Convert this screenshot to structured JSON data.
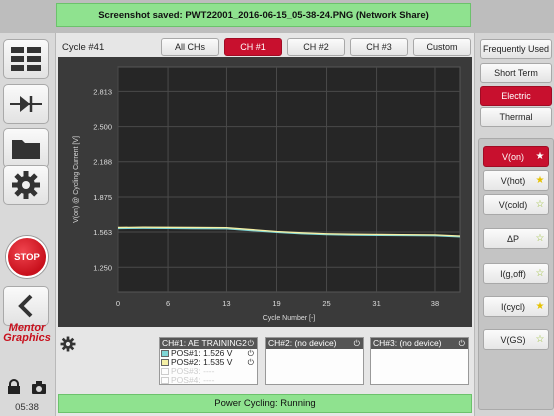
{
  "banner": {
    "message": "Screenshot saved: PWT22001_2016-06-15_05-38-24.PNG (Network Share)"
  },
  "left": {
    "buttons": [
      "grid-layout-icon",
      "diode-icon",
      "folder-icon",
      "gear-icon"
    ],
    "stop_label": "STOP",
    "back_icon": "chevron-left-icon",
    "logo_text": "Mentor Graphics",
    "clock": "05:38"
  },
  "main": {
    "cycle_label": "Cycle #41",
    "tabs": [
      {
        "label": "All CHs",
        "active": false
      },
      {
        "label": "CH #1",
        "active": true
      },
      {
        "label": "CH #2",
        "active": false
      },
      {
        "label": "CH #3",
        "active": false
      },
      {
        "label": "Custom",
        "active": false
      }
    ],
    "channels": [
      {
        "header": "CH#1: AE TRAINING2",
        "positions": [
          {
            "label": "POS#1: 1.526 V",
            "swatch": "#7fd6d6",
            "dim": false
          },
          {
            "label": "POS#2: 1.535 V",
            "swatch": "#f5f0a6",
            "dim": false
          },
          {
            "label": "POS#3: ----",
            "swatch": "#ffffff",
            "dim": true
          },
          {
            "label": "POS#4: ----",
            "swatch": "#ffffff",
            "dim": true
          }
        ]
      },
      {
        "header": "CH#2: (no device)",
        "positions": []
      },
      {
        "header": "CH#3: (no device)",
        "positions": []
      }
    ],
    "status": "Power Cycling: Running"
  },
  "chart_data": {
    "type": "line",
    "xlabel": "Cycle Number [-]",
    "ylabel": "V(on) @ Cycling Current [V]",
    "xlim": [
      0,
      41
    ],
    "ylim": [
      1.03,
      3.03
    ],
    "xticks": [
      "0",
      "6",
      "13",
      "19",
      "25",
      "31",
      "38"
    ],
    "yticks": [
      "1.250",
      "1.563",
      "1.875",
      "2.188",
      "2.500",
      "2.813"
    ],
    "grid": true,
    "series": [
      {
        "name": "POS#1",
        "color": "#7fd6d6",
        "x": [
          0,
          3,
          6,
          9,
          13,
          16,
          19,
          22,
          25,
          28,
          31,
          34,
          38,
          41
        ],
        "y": [
          1.595,
          1.597,
          1.596,
          1.594,
          1.592,
          1.576,
          1.56,
          1.548,
          1.54,
          1.536,
          1.534,
          1.532,
          1.53,
          1.52
        ]
      },
      {
        "name": "POS#2",
        "color": "#f5f0a6",
        "x": [
          0,
          3,
          6,
          9,
          13,
          16,
          19,
          22,
          25,
          28,
          31,
          34,
          38,
          41
        ],
        "y": [
          1.604,
          1.606,
          1.605,
          1.604,
          1.602,
          1.585,
          1.568,
          1.556,
          1.548,
          1.544,
          1.542,
          1.54,
          1.538,
          1.528
        ]
      }
    ]
  },
  "right": {
    "top_buttons": [
      {
        "label": "Frequently Used",
        "active": false
      },
      {
        "label": "Short Term",
        "active": false
      },
      {
        "label": "Electric",
        "active": true
      },
      {
        "label": "Thermal",
        "active": false
      }
    ],
    "params": [
      {
        "label": "V(on)",
        "active": true,
        "star": "filled"
      },
      {
        "label": "V(hot)",
        "active": false,
        "star": "yellow"
      },
      {
        "label": "V(cold)",
        "active": false,
        "star": "outline"
      },
      {
        "label": "ΔP",
        "active": false,
        "star": "outline"
      },
      {
        "label": "I(g,off)",
        "active": false,
        "star": "outline"
      },
      {
        "label": "I(cycl)",
        "active": false,
        "star": "yellow"
      },
      {
        "label": "V(GS)",
        "active": false,
        "star": "outline"
      }
    ]
  }
}
